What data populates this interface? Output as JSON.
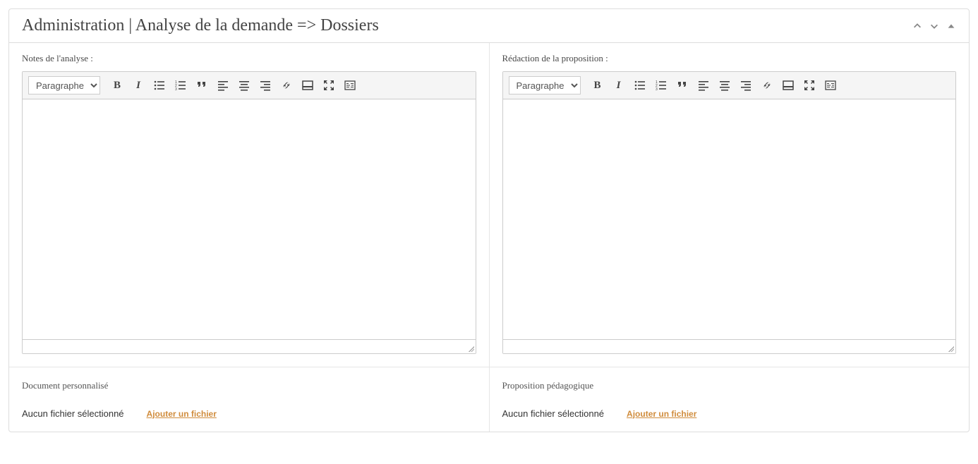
{
  "page_title": "Administration | Analyse de la demande => Dossiers",
  "paragraph_option": "Paragraphe",
  "left": {
    "label": "Notes de l'analyse :",
    "file_title": "Document personnalisé",
    "file_status": "Aucun fichier sélectionné",
    "file_link": "Ajouter un fichier"
  },
  "right": {
    "label": "Rédaction de la proposition :",
    "file_title": "Proposition pédagogique",
    "file_status": "Aucun fichier sélectionné",
    "file_link": "Ajouter un fichier"
  }
}
